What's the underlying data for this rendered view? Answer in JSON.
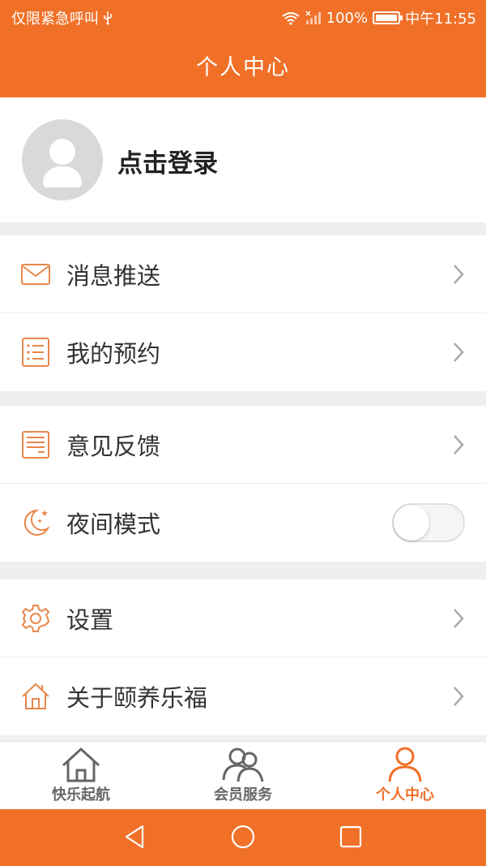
{
  "status_bar": {
    "carrier": "仅限紧急呼叫",
    "usb_icon": "usb-icon",
    "battery_percent": "100%",
    "time": "中午11:55"
  },
  "header": {
    "title": "个人中心"
  },
  "profile": {
    "login_label": "点击登录"
  },
  "groups": [
    {
      "items": [
        {
          "label": "消息推送",
          "icon": "mail-icon"
        },
        {
          "label": "我的预约",
          "icon": "list-icon"
        }
      ]
    },
    {
      "items": [
        {
          "label": "意见反馈",
          "icon": "feedback-icon"
        },
        {
          "label": "夜间模式",
          "icon": "moon-icon",
          "toggle": false
        }
      ]
    },
    {
      "items": [
        {
          "label": "设置",
          "icon": "gear-icon"
        },
        {
          "label": "关于颐养乐福",
          "icon": "home-icon"
        }
      ]
    }
  ],
  "tabs": [
    {
      "label": "快乐起航",
      "icon": "house-icon",
      "active": false
    },
    {
      "label": "会员服务",
      "icon": "members-icon",
      "active": false
    },
    {
      "label": "个人中心",
      "icon": "person-icon",
      "active": true
    }
  ],
  "colors": {
    "accent": "#f07028",
    "icon_orange": "#e8874a",
    "background": "#efefef"
  }
}
